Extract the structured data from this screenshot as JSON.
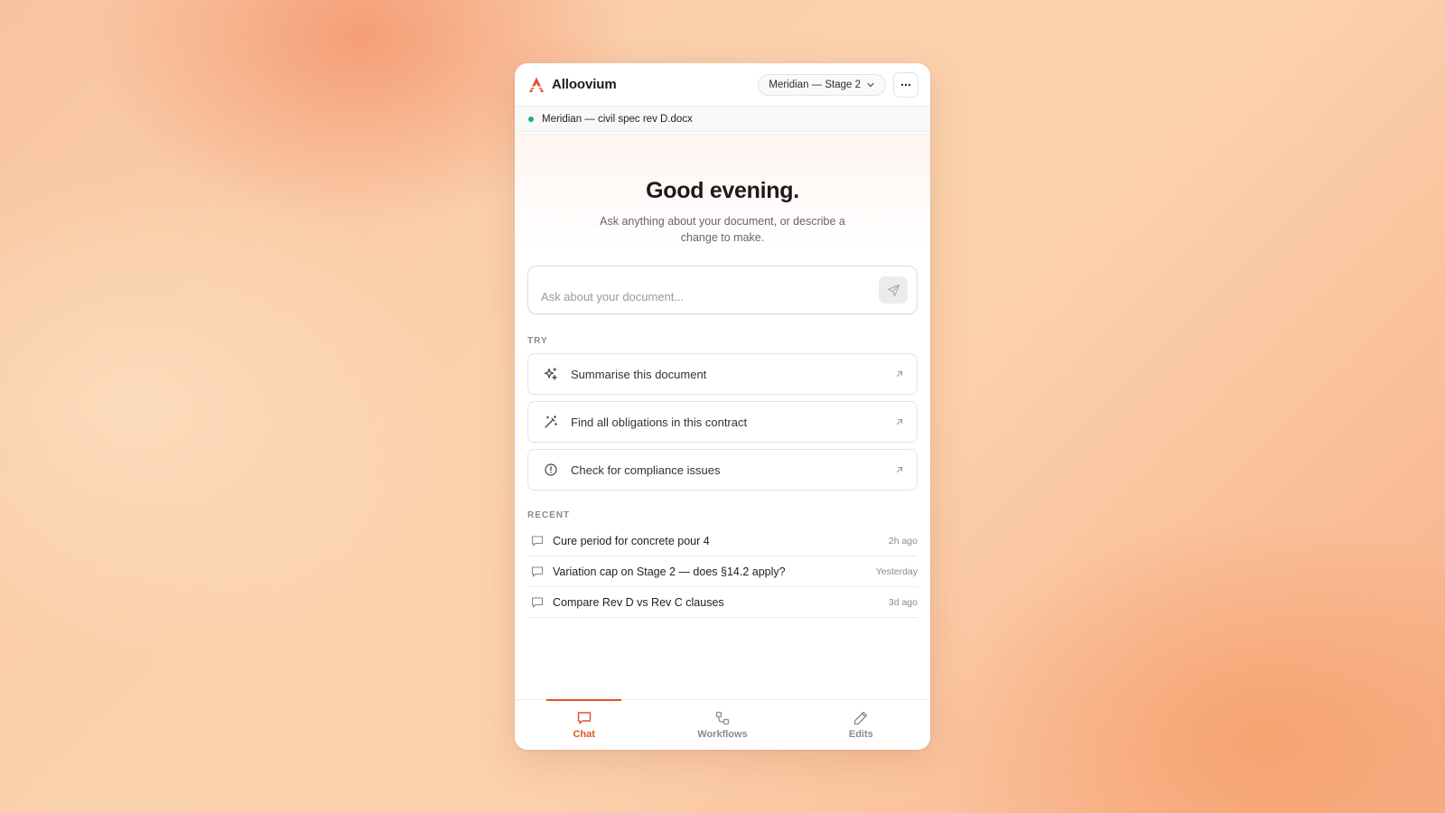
{
  "app": {
    "name": "Alloovium",
    "logo_icon": "alloovium-logo-icon",
    "accent_color": "#e2532a"
  },
  "header": {
    "project_selector": "Meridian — Stage 2",
    "more_icon": "more-horizontal-icon"
  },
  "document": {
    "name": "Meridian — civil spec rev D.docx",
    "status_color": "#1fb07a"
  },
  "greeting": {
    "title": "Good evening.",
    "subtitle": "Ask anything about your document, or describe a change to make."
  },
  "composer": {
    "placeholder": "Ask about your document...",
    "send_icon": "send-icon"
  },
  "try_section": {
    "label": "TRY",
    "items": [
      {
        "label": "Summarise this document",
        "icon": "sparkles-icon"
      },
      {
        "label": "Find all obligations in this contract",
        "icon": "magic-wand-icon"
      },
      {
        "label": "Check for compliance issues",
        "icon": "alert-circle-icon"
      }
    ]
  },
  "recent_section": {
    "label": "RECENT",
    "items": [
      {
        "title": "Cure period for concrete pour 4",
        "time": "2h ago"
      },
      {
        "title": "Variation cap on Stage 2 — does §14.2 apply?",
        "time": "Yesterday"
      },
      {
        "title": "Compare Rev D vs Rev C clauses",
        "time": "3d ago"
      }
    ]
  },
  "tabs": [
    {
      "label": "Chat",
      "icon": "chat-icon",
      "active": true
    },
    {
      "label": "Workflows",
      "icon": "workflow-icon",
      "active": false
    },
    {
      "label": "Edits",
      "icon": "pencil-icon",
      "active": false
    }
  ]
}
